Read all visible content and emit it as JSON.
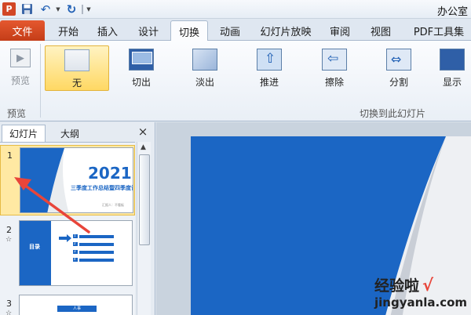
{
  "window": {
    "title": "办公室"
  },
  "quick_access": {
    "app_icon": "P"
  },
  "tabs": [
    {
      "label": "文件",
      "key": "file"
    },
    {
      "label": "开始",
      "key": "home"
    },
    {
      "label": "插入",
      "key": "insert"
    },
    {
      "label": "设计",
      "key": "design"
    },
    {
      "label": "切换",
      "key": "transitions",
      "active": true
    },
    {
      "label": "动画",
      "key": "animations"
    },
    {
      "label": "幻灯片放映",
      "key": "slideshow"
    },
    {
      "label": "审阅",
      "key": "review"
    },
    {
      "label": "视图",
      "key": "view"
    },
    {
      "label": "PDF工具集",
      "key": "pdf"
    }
  ],
  "ribbon": {
    "preview": {
      "label": "预览",
      "group_label": "预览"
    },
    "transitions": [
      {
        "label": "无",
        "icon": "none-transition-icon",
        "selected": true
      },
      {
        "label": "切出",
        "icon": "cut-transition-icon"
      },
      {
        "label": "淡出",
        "icon": "fade-transition-icon"
      },
      {
        "label": "推进",
        "icon": "push-transition-icon"
      },
      {
        "label": "擦除",
        "icon": "wipe-transition-icon"
      },
      {
        "label": "分割",
        "icon": "split-transition-icon"
      },
      {
        "label": "显示",
        "icon": "reveal-transition-icon"
      }
    ],
    "group_label": "切换到此幻灯片"
  },
  "panel": {
    "tabs": [
      {
        "label": "幻灯片",
        "active": true
      },
      {
        "label": "大纲"
      }
    ],
    "close": "×",
    "slides": [
      {
        "number": "1",
        "title": "2021",
        "subtitle": "三季度工作总结暨四季度计划",
        "byline": "汇报人：不看板"
      },
      {
        "number": "2",
        "star": "☆",
        "title": "目录",
        "items": [
          "1",
          "2",
          "3",
          "4"
        ]
      },
      {
        "number": "3",
        "star": "☆",
        "banner": "人事"
      }
    ]
  },
  "watermark": {
    "text": "经验啦",
    "check": "√",
    "url": "jingyanla.com"
  },
  "colors": {
    "accent": "#1b66c4",
    "file_tab": "#d24726",
    "arrow": "#e8453a"
  }
}
